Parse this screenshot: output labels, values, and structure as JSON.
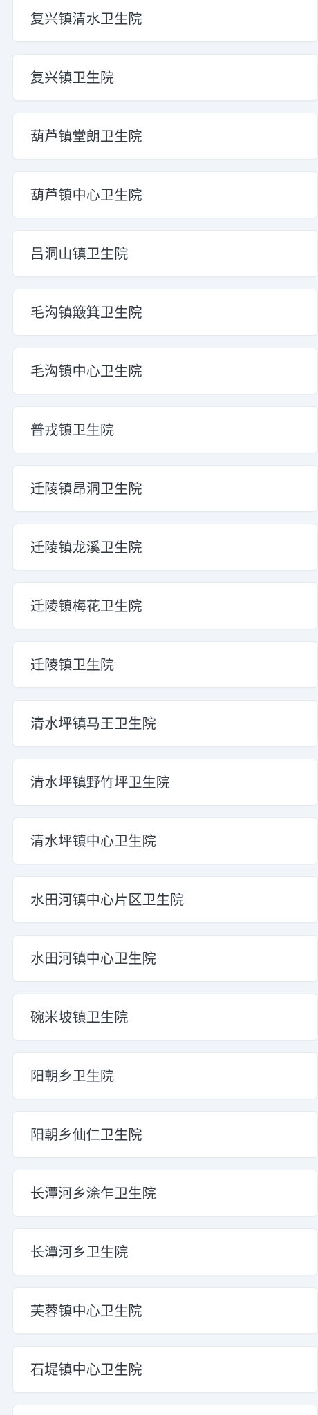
{
  "list": {
    "items": [
      {
        "label": "复兴镇清水卫生院"
      },
      {
        "label": "复兴镇卫生院"
      },
      {
        "label": "葫芦镇堂朗卫生院"
      },
      {
        "label": "葫芦镇中心卫生院"
      },
      {
        "label": "吕洞山镇卫生院"
      },
      {
        "label": "毛沟镇簸箕卫生院"
      },
      {
        "label": "毛沟镇中心卫生院"
      },
      {
        "label": "普戎镇卫生院"
      },
      {
        "label": "迁陵镇昂洞卫生院"
      },
      {
        "label": "迁陵镇龙溪卫生院"
      },
      {
        "label": "迁陵镇梅花卫生院"
      },
      {
        "label": "迁陵镇卫生院"
      },
      {
        "label": "清水坪镇马王卫生院"
      },
      {
        "label": "清水坪镇野竹坪卫生院"
      },
      {
        "label": "清水坪镇中心卫生院"
      },
      {
        "label": "水田河镇中心片区卫生院"
      },
      {
        "label": "水田河镇中心卫生院"
      },
      {
        "label": "碗米坡镇卫生院"
      },
      {
        "label": "阳朝乡卫生院"
      },
      {
        "label": "阳朝乡仙仁卫生院"
      },
      {
        "label": "长潭河乡涂乍卫生院"
      },
      {
        "label": "长潭河乡卫生院"
      },
      {
        "label": "芙蓉镇中心卫生院"
      },
      {
        "label": "石堤镇中心卫生院"
      },
      {
        "label": ""
      }
    ]
  }
}
